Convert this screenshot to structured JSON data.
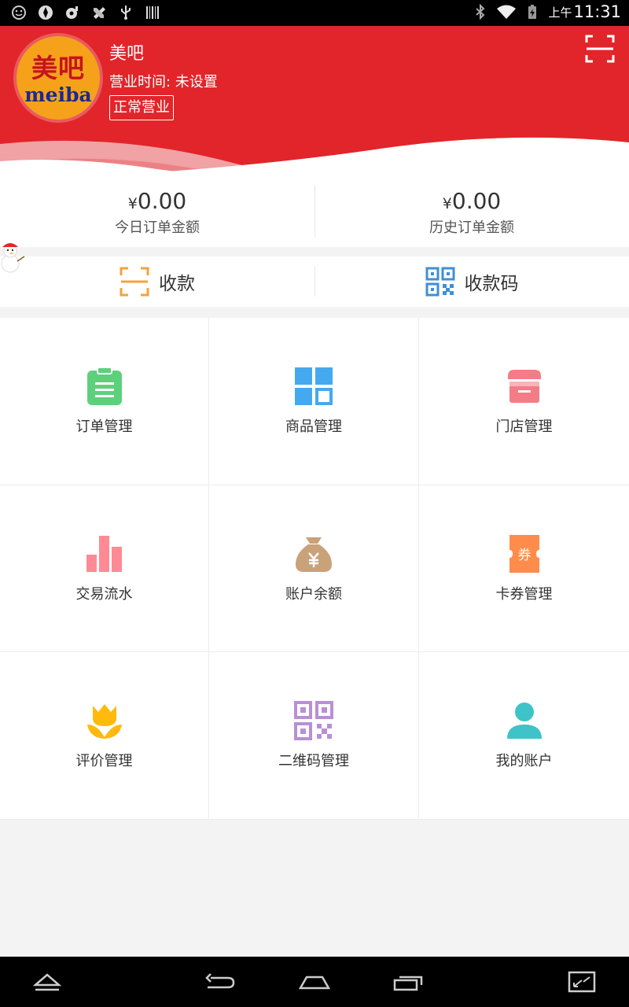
{
  "status_bar": {
    "ampm": "上午",
    "time": "11:31"
  },
  "store": {
    "logo_cn": "美吧",
    "logo_en": "meiba",
    "name": "美吧",
    "hours": "营业时间: 未设置",
    "status": "正常营业"
  },
  "summary": {
    "currency": "¥",
    "today_amount": "0.00",
    "today_label": "今日订单金额",
    "history_amount": "0.00",
    "history_label": "历史订单金额"
  },
  "pay": {
    "collect_label": "收款",
    "qrcode_label": "收款码"
  },
  "menu": [
    {
      "label": "订单管理",
      "icon": "clipboard-icon",
      "color": "#5dd07c"
    },
    {
      "label": "商品管理",
      "icon": "grid-icon",
      "color": "#45a9ef"
    },
    {
      "label": "门店管理",
      "icon": "store-icon",
      "color": "#f47c86"
    },
    {
      "label": "交易流水",
      "icon": "bar-chart-icon",
      "color": "#ff8a95"
    },
    {
      "label": "账户余额",
      "icon": "money-bag-icon",
      "color": "#c9a27a"
    },
    {
      "label": "卡券管理",
      "icon": "coupon-icon",
      "color": "#ff8c4a"
    },
    {
      "label": "评价管理",
      "icon": "flower-icon",
      "color": "#ffba0d"
    },
    {
      "label": "二维码管理",
      "icon": "qr-code-icon",
      "color": "#b98fd6"
    },
    {
      "label": "我的账户",
      "icon": "user-icon",
      "color": "#3ec3c8"
    }
  ],
  "coupon_glyph": "券",
  "colors": {
    "header_red": "#e2252a",
    "scan_orange": "#f4a23c",
    "qr_blue": "#3f8fd6"
  }
}
